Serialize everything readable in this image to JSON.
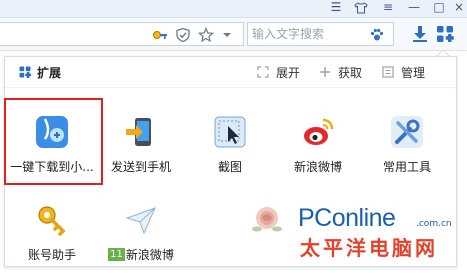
{
  "toolbar": {
    "search_placeholder": "输入文字搜索"
  },
  "panel": {
    "title": "扩展",
    "expand_label": "展开",
    "fetch_label": "获取",
    "manage_label": "管理"
  },
  "extensions": [
    {
      "label": "一键下载到小..."
    },
    {
      "label": "发送到手机"
    },
    {
      "label": "截图"
    },
    {
      "label": "新浪微博"
    },
    {
      "label": "常用工具"
    },
    {
      "label": "账号助手"
    },
    {
      "label": "新浪微博",
      "badge": "11"
    },
    {
      "label": ""
    }
  ],
  "watermark": {
    "brand": "PConline",
    "domain": ".com.cn",
    "cn": "太平洋电脑网"
  },
  "colors": {
    "highlight": "#e02121",
    "brand_blue": "#1b5fb0",
    "brand_red": "#e0432d"
  }
}
